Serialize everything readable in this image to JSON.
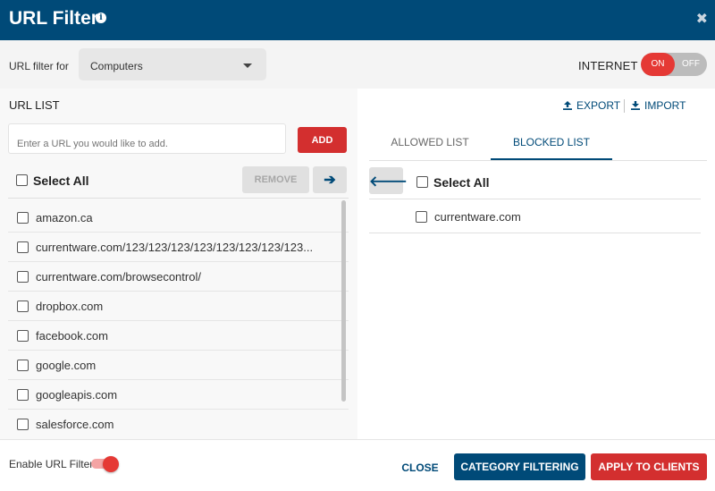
{
  "dialog": {
    "title": "URL Filter",
    "info_icon": "i",
    "close_icon": "✖"
  },
  "filter": {
    "label": "URL filter for",
    "selected": "Computers",
    "internet_label": "INTERNET",
    "toggle_on": "ON",
    "toggle_off": "OFF",
    "internet_enabled": true
  },
  "url_list": {
    "heading": "URL LIST",
    "input_placeholder": "Enter a URL you would like to add.",
    "add_label": "ADD",
    "select_all": "Select All",
    "remove_label": "REMOVE",
    "move_icon": "arrow-right-icon",
    "items": [
      "amazon.ca",
      "currentware.com/123/123/123/123/123/123/123/123...",
      "currentware.com/browsecontrol/",
      "dropbox.com",
      "facebook.com",
      "google.com",
      "googleapis.com",
      "salesforce.com"
    ]
  },
  "lists": {
    "export_label": "EXPORT",
    "import_label": "IMPORT",
    "tabs": [
      "ALLOWED LIST",
      "BLOCKED LIST"
    ],
    "active_tab": "BLOCKED LIST",
    "back_icon": "arrow-left-icon",
    "select_all": "Select All",
    "blocked_items": [
      "currentware.com"
    ]
  },
  "footer": {
    "enable_label": "Enable URL Filter",
    "enable_state": true,
    "close_label": "CLOSE",
    "category_label": "CATEGORY FILTERING",
    "apply_label": "APPLY TO CLIENTS"
  },
  "colors": {
    "header": "#004a78",
    "accent_red": "#d32f2f",
    "primary_blue": "#004a78"
  }
}
